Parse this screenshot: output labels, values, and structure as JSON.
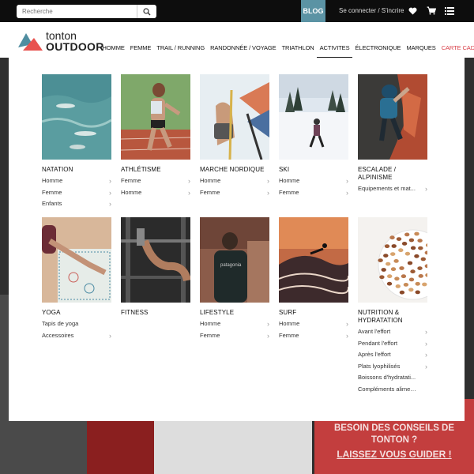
{
  "topbar": {
    "search_placeholder": "Recherche",
    "blog_label": "BLOG",
    "login_label": "Se connecter / S'incrire",
    "icons": [
      "search-icon",
      "heart-icon",
      "cart-icon",
      "menu-icon"
    ]
  },
  "logo": {
    "line1": "tonton",
    "line2": "OUTDOOR"
  },
  "nav": [
    {
      "label": "HOMME"
    },
    {
      "label": "FEMME"
    },
    {
      "label": "TRAIL / RUNNING"
    },
    {
      "label": "RANDONNÉE / VOYAGE"
    },
    {
      "label": "TRIATHLON"
    },
    {
      "label": "ACTIVITES",
      "active": true
    },
    {
      "label": "ÉLECTRONIQUE"
    },
    {
      "label": "MARQUES"
    },
    {
      "label": "CARTE CADEAU",
      "color": "#d9414a"
    }
  ],
  "categories": [
    {
      "title": "NATATION",
      "links": [
        {
          "label": "Homme",
          "chevron": true
        },
        {
          "label": "Femme",
          "chevron": true
        },
        {
          "label": "Enfants",
          "chevron": true
        }
      ]
    },
    {
      "title": "ATHLÉTISME",
      "links": [
        {
          "label": "Femme",
          "chevron": true
        },
        {
          "label": "Homme",
          "chevron": true
        }
      ]
    },
    {
      "title": "MARCHE NORDIQUE",
      "links": [
        {
          "label": "Homme",
          "chevron": true
        },
        {
          "label": "Femme",
          "chevron": true
        }
      ]
    },
    {
      "title": "SKI",
      "links": [
        {
          "label": "Homme",
          "chevron": true
        },
        {
          "label": "Femme",
          "chevron": true
        }
      ]
    },
    {
      "title": "ESCALADE / ALPINISME",
      "links": [
        {
          "label": "Equipements et mat...",
          "chevron": true
        }
      ]
    },
    {
      "title": "YOGA",
      "links": [
        {
          "label": "Tapis de yoga",
          "chevron": false
        },
        {
          "label": "Accessoires",
          "chevron": true
        }
      ]
    },
    {
      "title": "FITNESS",
      "links": []
    },
    {
      "title": "LIFESTYLE",
      "links": [
        {
          "label": "Homme",
          "chevron": true
        },
        {
          "label": "Femme",
          "chevron": true
        }
      ]
    },
    {
      "title": "SURF",
      "links": [
        {
          "label": "Homme",
          "chevron": true
        },
        {
          "label": "Femme",
          "chevron": true
        }
      ]
    },
    {
      "title": "NUTRITION & HYDRATATION",
      "links": [
        {
          "label": "Avant l'effort",
          "chevron": true
        },
        {
          "label": "Pendant l'effort",
          "chevron": true
        },
        {
          "label": "Après l'effort",
          "chevron": true
        },
        {
          "label": "Plats lyophilisés",
          "chevron": true
        },
        {
          "label": "Boissons d'hydratati...",
          "chevron": false
        },
        {
          "label": "Compléments alimen...",
          "chevron": false
        }
      ]
    }
  ],
  "promo": {
    "text": "BESOIN DES CONSEILS DE TONTON ?",
    "cta": "LAISSEZ VOUS GUIDER !"
  },
  "colors": {
    "accent": "#5b93a4",
    "red": "#d9414a",
    "promo": "#c33e3e"
  }
}
